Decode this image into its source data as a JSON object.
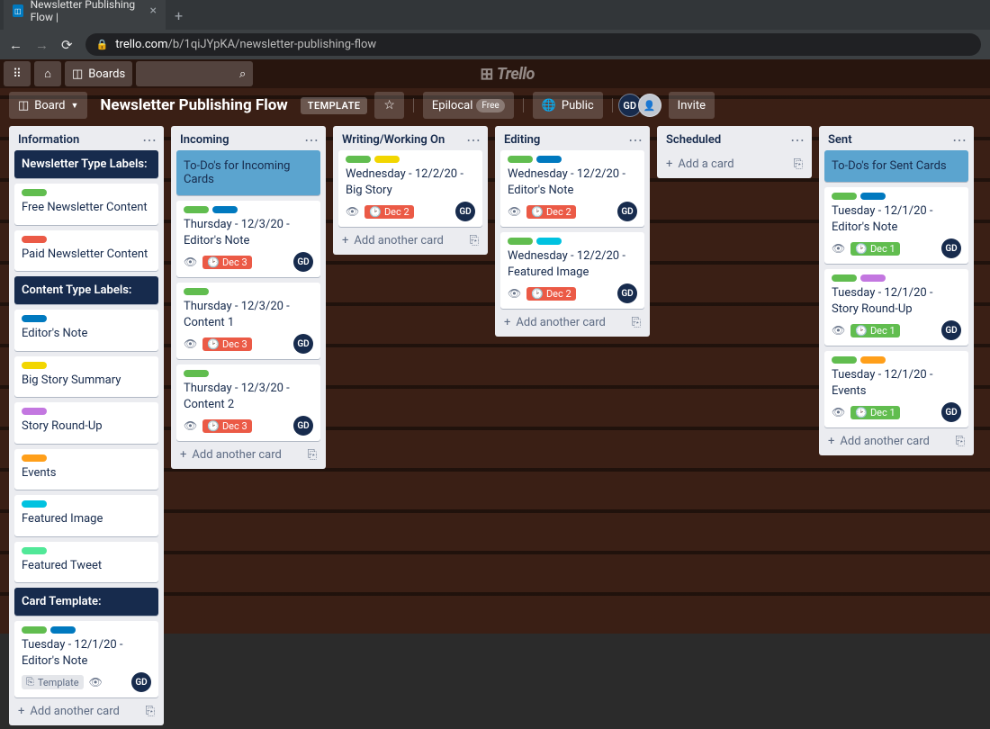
{
  "browser": {
    "tab_title": "Newsletter Publishing Flow |",
    "url_prefix": "trello.com",
    "url_path": "/b/1qiJYpKA/newsletter-publishing-flow"
  },
  "topbar": {
    "boards": "Boards",
    "logo": "Trello"
  },
  "header": {
    "board_btn": "Board",
    "title": "Newsletter Publishing Flow",
    "template": "TEMPLATE",
    "workspace": "Epilocal",
    "workspace_tag": "Free",
    "visibility": "Public",
    "invite": "Invite",
    "member_initials": "GD"
  },
  "ui": {
    "add_another_card": "Add another card",
    "add_a_card": "Add a card",
    "template_badge": "Template"
  },
  "lists": [
    {
      "title": "Information",
      "sections": [
        {
          "type": "section",
          "text": "Newsletter Type Labels:"
        },
        {
          "type": "card",
          "title": "Free Newsletter Content",
          "labels": [
            "green"
          ]
        },
        {
          "type": "card",
          "title": "Paid Newsletter Content",
          "labels": [
            "red"
          ]
        },
        {
          "type": "section",
          "text": "Content Type Labels:"
        },
        {
          "type": "card",
          "title": "Editor's Note",
          "labels": [
            "blue"
          ]
        },
        {
          "type": "card",
          "title": "Big Story Summary",
          "labels": [
            "yellow"
          ]
        },
        {
          "type": "card",
          "title": "Story Round-Up",
          "labels": [
            "purple"
          ]
        },
        {
          "type": "card",
          "title": "Events",
          "labels": [
            "orange"
          ]
        },
        {
          "type": "card",
          "title": "Featured Image",
          "labels": [
            "sky"
          ]
        },
        {
          "type": "card",
          "title": "Featured Tweet",
          "labels": [
            "lime"
          ]
        },
        {
          "type": "section",
          "text": "Card Template:"
        },
        {
          "type": "card",
          "title": "Tuesday - 12/1/20 - Editor's Note",
          "labels": [
            "green",
            "blue"
          ],
          "template": true,
          "watch": true,
          "member": "GD"
        }
      ]
    },
    {
      "title": "Incoming",
      "sections": [
        {
          "type": "todo",
          "text": "To-Do's for Incoming Cards"
        },
        {
          "type": "card",
          "title": "Thursday - 12/3/20 - Editor's Note",
          "labels": [
            "green",
            "blue"
          ],
          "watch": true,
          "date": "Dec 3",
          "dateColor": "red",
          "member": "GD"
        },
        {
          "type": "card",
          "title": "Thursday - 12/3/20 - Content 1",
          "labels": [
            "green"
          ],
          "watch": true,
          "date": "Dec 3",
          "dateColor": "red",
          "member": "GD"
        },
        {
          "type": "card",
          "title": "Thursday - 12/3/20 - Content 2",
          "labels": [
            "green"
          ],
          "watch": true,
          "date": "Dec 3",
          "dateColor": "red",
          "member": "GD"
        }
      ]
    },
    {
      "title": "Writing/Working On",
      "sections": [
        {
          "type": "card",
          "title": "Wednesday - 12/2/20 - Big Story",
          "labels": [
            "green",
            "yellow"
          ],
          "watch": true,
          "date": "Dec 2",
          "dateColor": "red",
          "member": "GD"
        }
      ]
    },
    {
      "title": "Editing",
      "sections": [
        {
          "type": "card",
          "title": "Wednesday - 12/2/20 - Editor's Note",
          "labels": [
            "green",
            "blue"
          ],
          "watch": true,
          "date": "Dec 2",
          "dateColor": "red",
          "member": "GD"
        },
        {
          "type": "card",
          "title": "Wednesday - 12/2/20 - Featured Image",
          "labels": [
            "green",
            "sky"
          ],
          "watch": true,
          "date": "Dec 2",
          "dateColor": "red",
          "member": "GD"
        }
      ]
    },
    {
      "title": "Scheduled",
      "sections": [],
      "empty_add": true
    },
    {
      "title": "Sent",
      "sections": [
        {
          "type": "todo",
          "text": "To-Do's for Sent Cards"
        },
        {
          "type": "card",
          "title": "Tuesday - 12/1/20 - Editor's Note",
          "labels": [
            "green",
            "blue"
          ],
          "watch": true,
          "date": "Dec 1",
          "dateColor": "green",
          "member": "GD"
        },
        {
          "type": "card",
          "title": "Tuesday - 12/1/20 - Story Round-Up",
          "labels": [
            "green",
            "purple"
          ],
          "watch": true,
          "date": "Dec 1",
          "dateColor": "green",
          "member": "GD"
        },
        {
          "type": "card",
          "title": "Tuesday - 12/1/20 - Events",
          "labels": [
            "green",
            "orange"
          ],
          "watch": true,
          "date": "Dec 1",
          "dateColor": "green",
          "member": "GD"
        }
      ]
    }
  ]
}
